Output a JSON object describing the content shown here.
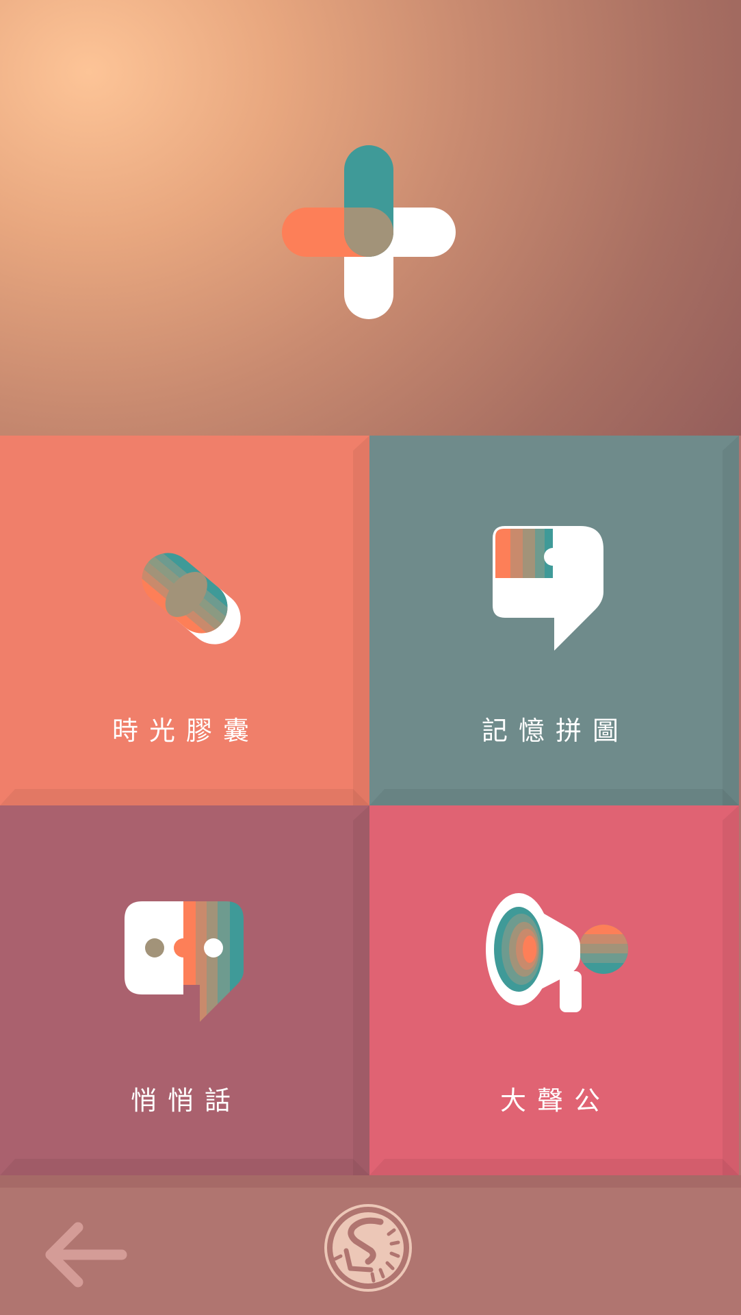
{
  "tiles": [
    {
      "id": "capsule",
      "label": "時光膠囊",
      "icon": "time-capsule-pill-icon",
      "color": "#f07f6a"
    },
    {
      "id": "puzzle",
      "label": "記憶拼圖",
      "icon": "memory-puzzle-chat-icon",
      "color": "#6f8b8b"
    },
    {
      "id": "whisper",
      "label": "悄悄話",
      "icon": "whisper-chat-bubble-icon",
      "color": "#aa616e"
    },
    {
      "id": "megaphone",
      "label": "大聲公",
      "icon": "megaphone-icon",
      "color": "#e06373"
    }
  ],
  "header": {
    "logo": "cross-plus-logo-icon"
  },
  "bottom_bar": {
    "back_icon": "back-arrow-icon",
    "home_icon": "app-logo-icon"
  },
  "colors": {
    "teal": "#3f9a98",
    "orange": "#fd7f58",
    "khaki": "#a29379",
    "white": "#ffffff"
  }
}
